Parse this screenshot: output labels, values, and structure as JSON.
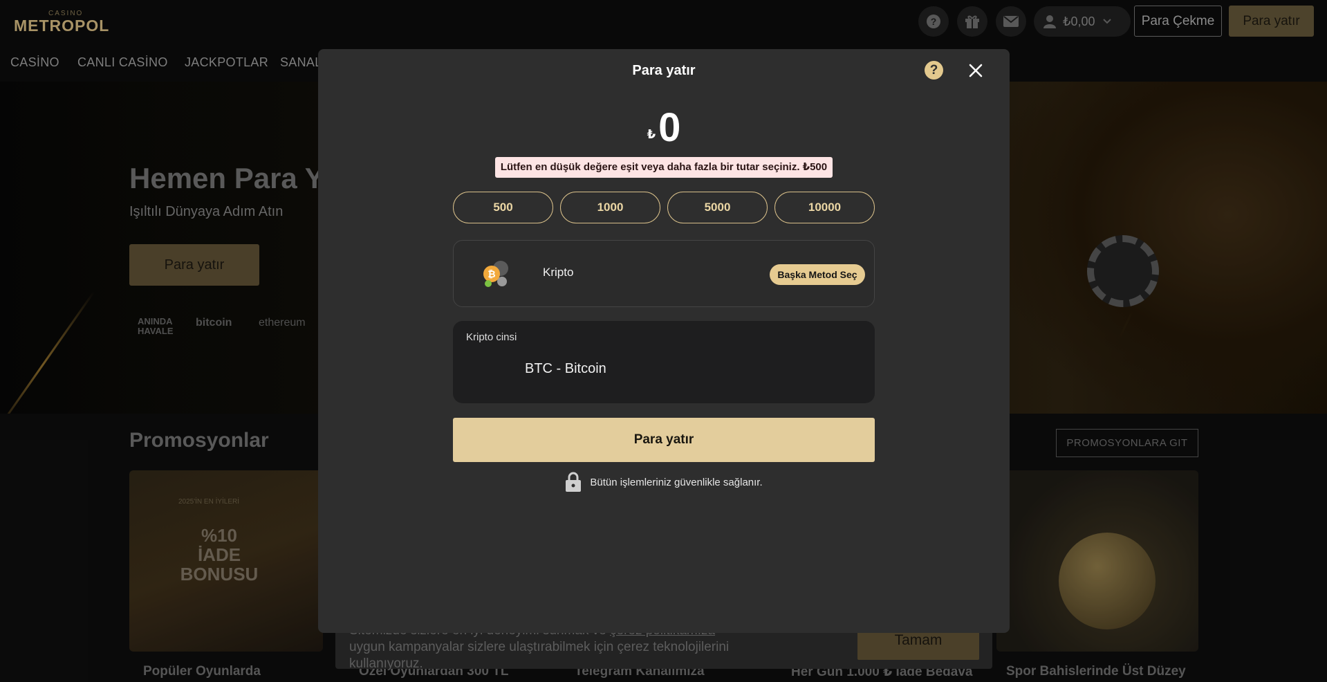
{
  "header": {
    "logo_small": "CASINO",
    "logo_big": "METROPOL",
    "balance": "₺0,00",
    "withdraw_label": "Para Çekme",
    "deposit_label": "Para yatır"
  },
  "nav": {
    "items": [
      "CASİNO",
      "CANLI CASİNO",
      "JACKPOTLAR",
      "SANAL"
    ]
  },
  "hero": {
    "title": "Hemen Para Y",
    "subtitle": "Işıltılı Dünyaya Adım Atın",
    "button": "Para yatır",
    "payment_logos": [
      "ANINDA HAVALE",
      "bitcoin",
      "ethereum"
    ]
  },
  "promotions": {
    "title": "Promosyonlar",
    "go_button": "PROMOSYONLARA GIT",
    "card_badge": "%10 İADE BONUSU",
    "card_badge_year": "2025'İN EN İYİLERİ",
    "captions": [
      "Popüler Oyunlarda",
      "Özel Oyunlardan 300 TL",
      "Telegram Kanalımıza",
      "Her Gün 1.000 ₺ İade Bedava",
      "Spor Bahislerinde Üst Düzey"
    ]
  },
  "cookie": {
    "text_before": "Sitemizde sizlere en iyi deneyimi sunmak ve ",
    "link": "çerez politikamıza",
    "text_after": " uygun kampanyalar sizlere ulaştırabilmek için çerez teknolojilerini kullanıyoruz.",
    "accept": "Tamam"
  },
  "modal": {
    "title": "Para yatır",
    "currency_symbol": "₺",
    "amount": "0",
    "min_warning": "Lütfen en düşük değere eşit veya daha fazla bir tutar seçiniz. ₺500",
    "quick_amounts": [
      "500",
      "1000",
      "5000",
      "10000"
    ],
    "method": {
      "name": "Kripto",
      "change_label": "Başka Metod Seç"
    },
    "crypto_select": {
      "label": "Kripto cinsi",
      "value": "BTC - Bitcoin"
    },
    "submit": "Para yatır",
    "secure_note": "Bütün işlemleriniz güvenlikle sağlanır."
  },
  "colors": {
    "accent_gold": "#e3cd9c",
    "modal_bg": "#2e2e2e",
    "warning_bg": "#fde4e4",
    "page_bg": "#0d0d0d"
  }
}
